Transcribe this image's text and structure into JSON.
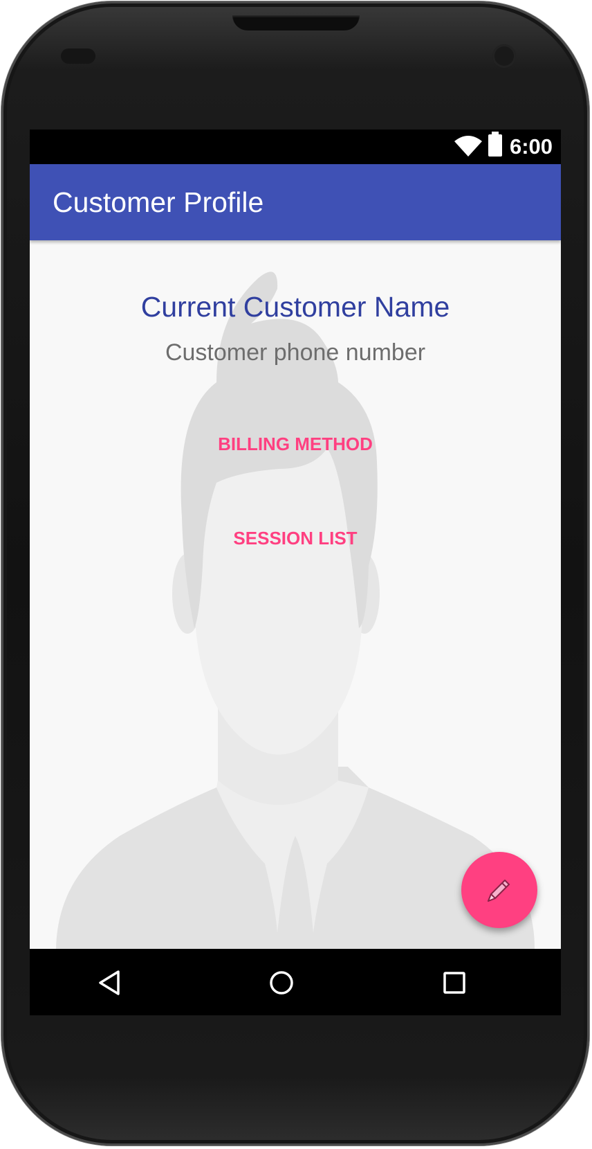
{
  "status_bar": {
    "time": "6:00",
    "icons": [
      "wifi-icon",
      "battery-icon"
    ]
  },
  "app_bar": {
    "title": "Customer Profile"
  },
  "profile": {
    "name": "Current Customer Name",
    "phone": "Customer phone number",
    "avatar_icon": "person-placeholder-icon"
  },
  "actions": {
    "billing_label": "BILLING METHOD",
    "sessions_label": "SESSION LIST"
  },
  "fab": {
    "icon": "pencil-icon"
  },
  "nav_bar": {
    "icons": [
      "back-icon",
      "home-icon",
      "recents-icon"
    ]
  },
  "colors": {
    "primary": "#3f51b5",
    "primary_dark_text": "#303f9f",
    "accent": "#ff4081",
    "background": "#f8f8f8"
  }
}
